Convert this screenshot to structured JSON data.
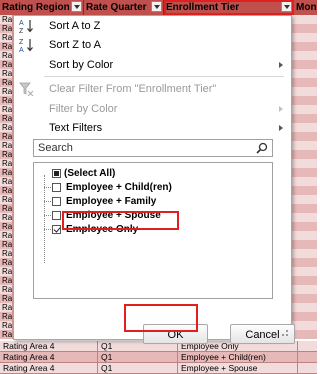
{
  "sheet": {
    "headers": [
      "Rating Region",
      "Rate Quarter",
      "Enrollment Tier",
      "Mon"
    ],
    "row_stub": "Rati",
    "bottom_rows": [
      [
        "Rating Area 4",
        "Q1",
        "Employee Only"
      ],
      [
        "Rating Area 4",
        "Q1",
        "Employee + Child(ren)"
      ],
      [
        "Rating Area 4",
        "Q1",
        "Employee + Spouse"
      ]
    ]
  },
  "menu": {
    "sort_az": "Sort A to Z",
    "sort_za": "Sort Z to A",
    "sort_by_color": "Sort by Color",
    "clear_filter": "Clear Filter From \"Enrollment Tier\"",
    "filter_by_color": "Filter by Color",
    "text_filters": "Text Filters",
    "search_placeholder": "Search",
    "items": [
      {
        "label": "(Select All)",
        "state": "mixed"
      },
      {
        "label": "Employee + Child(ren)",
        "state": "unchecked"
      },
      {
        "label": "Employee + Family",
        "state": "unchecked"
      },
      {
        "label": "Employee + Spouse",
        "state": "unchecked"
      },
      {
        "label": "Employee Only",
        "state": "checked"
      }
    ],
    "ok_label": "OK",
    "cancel_label": "Cancel"
  },
  "colors": {
    "header_bg": "#c0504d",
    "row_odd": "#f2dcdb",
    "row_even": "#e6b8b7",
    "highlight": "#e0201c"
  },
  "icons": {
    "sort_az": "sort-a-to-z-icon",
    "sort_za": "sort-z-to-a-icon",
    "clear_filter": "clear-filter-icon",
    "search": "magnifier-icon"
  }
}
